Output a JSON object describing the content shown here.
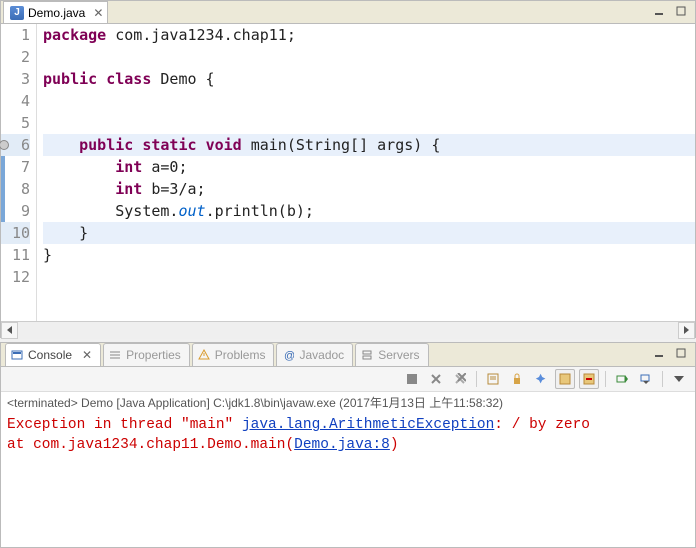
{
  "editor": {
    "tab": {
      "label": "Demo.java"
    },
    "lineHighlights": [
      6,
      10
    ],
    "lineMarkers": [
      6
    ],
    "selBar": {
      "start": 6,
      "end": 10
    },
    "code": [
      {
        "n": 1,
        "tokens": [
          {
            "t": "package",
            "c": "kw"
          },
          {
            "t": " com.java1234.chap11;",
            "c": "pln"
          }
        ]
      },
      {
        "n": 2,
        "tokens": []
      },
      {
        "n": 3,
        "tokens": [
          {
            "t": "public",
            "c": "kw"
          },
          {
            "t": " ",
            "c": "pln"
          },
          {
            "t": "class",
            "c": "kw"
          },
          {
            "t": " Demo {",
            "c": "pln"
          }
        ]
      },
      {
        "n": 4,
        "tokens": []
      },
      {
        "n": 5,
        "tokens": []
      },
      {
        "n": 6,
        "tokens": [
          {
            "t": "    ",
            "c": "pln"
          },
          {
            "t": "public",
            "c": "kw"
          },
          {
            "t": " ",
            "c": "pln"
          },
          {
            "t": "static",
            "c": "kw"
          },
          {
            "t": " ",
            "c": "pln"
          },
          {
            "t": "void",
            "c": "kw"
          },
          {
            "t": " main(String[] args) {",
            "c": "pln"
          }
        ]
      },
      {
        "n": 7,
        "tokens": [
          {
            "t": "        ",
            "c": "pln"
          },
          {
            "t": "int",
            "c": "kw"
          },
          {
            "t": " a=0;",
            "c": "pln"
          }
        ]
      },
      {
        "n": 8,
        "tokens": [
          {
            "t": "        ",
            "c": "pln"
          },
          {
            "t": "int",
            "c": "kw"
          },
          {
            "t": " b=3/a;",
            "c": "pln"
          }
        ]
      },
      {
        "n": 9,
        "tokens": [
          {
            "t": "        System.",
            "c": "pln"
          },
          {
            "t": "out",
            "c": "sf"
          },
          {
            "t": ".println(b);",
            "c": "pln"
          }
        ]
      },
      {
        "n": 10,
        "tokens": [
          {
            "t": "    }",
            "c": "pln"
          }
        ]
      },
      {
        "n": 11,
        "tokens": [
          {
            "t": "}",
            "c": "pln"
          }
        ]
      },
      {
        "n": 12,
        "tokens": []
      }
    ]
  },
  "views": [
    {
      "id": "console",
      "label": "Console",
      "active": true,
      "icon": "console-icon",
      "color": "#3b6db6",
      "closable": true
    },
    {
      "id": "properties",
      "label": "Properties",
      "active": false,
      "icon": "properties-icon",
      "color": "#3b6db6"
    },
    {
      "id": "problems",
      "label": "Problems",
      "active": false,
      "icon": "problems-icon",
      "color": "#d99b2e"
    },
    {
      "id": "javadoc",
      "label": "Javadoc",
      "active": false,
      "icon": "javadoc-icon",
      "color": "#3b6db6"
    },
    {
      "id": "servers",
      "label": "Servers",
      "active": false,
      "icon": "servers-icon",
      "color": "#3b6db6"
    }
  ],
  "console": {
    "launch": "<terminated> Demo [Java Application] C:\\jdk1.8\\bin\\javaw.exe (2017年1月13日 上午11:58:32)",
    "line1a": "Exception in thread \"main\" ",
    "line1b": "java.lang.ArithmeticException",
    "line1c": ": / by zero",
    "line2a": "        at com.java1234.chap11.Demo.main(",
    "line2b": "Demo.java:8",
    "line2c": ")"
  }
}
